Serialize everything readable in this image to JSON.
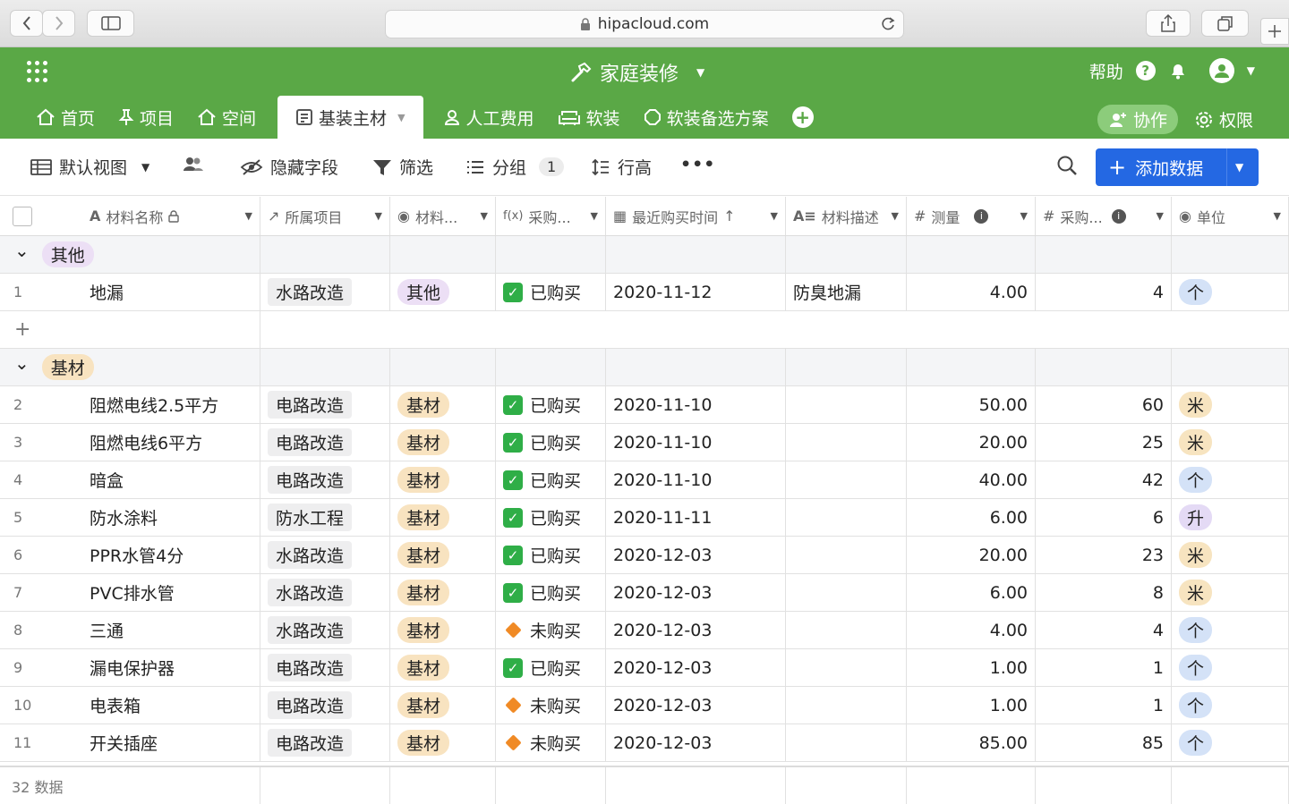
{
  "browser": {
    "url": "hipacloud.com"
  },
  "app": {
    "title": "家庭装修",
    "help_label": "帮助",
    "tabs": [
      {
        "label": "首页"
      },
      {
        "label": "项目"
      },
      {
        "label": "空间"
      },
      {
        "label": "基装主材"
      },
      {
        "label": "人工费用"
      },
      {
        "label": "软装"
      },
      {
        "label": "软装备选方案"
      }
    ],
    "collab_label": "协作",
    "perm_label": "权限"
  },
  "toolbar": {
    "view_label": "默认视图",
    "hide_fields": "隐藏字段",
    "filter": "筛选",
    "group": "分组",
    "group_count": "1",
    "row_height": "行高",
    "add_data": "添加数据"
  },
  "columns": [
    "材料名称",
    "所属项目",
    "材料...",
    "采购...",
    "最近购买时间",
    "材料描述",
    "测量",
    "采购...",
    "单位"
  ],
  "groups": [
    {
      "name": "其他",
      "rows": [
        {
          "n": "1",
          "name": "地漏",
          "project": "水路改造",
          "cat": "其他",
          "status": "已购买",
          "date": "2020-11-12",
          "desc": "防臭地漏",
          "measure": "4.00",
          "qty": "4",
          "unit": "个"
        }
      ]
    },
    {
      "name": "基材",
      "rows": [
        {
          "n": "2",
          "name": "阻燃电线2.5平方",
          "project": "电路改造",
          "cat": "基材",
          "status": "已购买",
          "date": "2020-11-10",
          "desc": "",
          "measure": "50.00",
          "qty": "60",
          "unit": "米"
        },
        {
          "n": "3",
          "name": "阻燃电线6平方",
          "project": "电路改造",
          "cat": "基材",
          "status": "已购买",
          "date": "2020-11-10",
          "desc": "",
          "measure": "20.00",
          "qty": "25",
          "unit": "米"
        },
        {
          "n": "4",
          "name": "暗盒",
          "project": "电路改造",
          "cat": "基材",
          "status": "已购买",
          "date": "2020-11-10",
          "desc": "",
          "measure": "40.00",
          "qty": "42",
          "unit": "个"
        },
        {
          "n": "5",
          "name": "防水涂料",
          "project": "防水工程",
          "cat": "基材",
          "status": "已购买",
          "date": "2020-11-11",
          "desc": "",
          "measure": "6.00",
          "qty": "6",
          "unit": "升"
        },
        {
          "n": "6",
          "name": "PPR水管4分",
          "project": "水路改造",
          "cat": "基材",
          "status": "已购买",
          "date": "2020-12-03",
          "desc": "",
          "measure": "20.00",
          "qty": "23",
          "unit": "米"
        },
        {
          "n": "7",
          "name": "PVC排水管",
          "project": "水路改造",
          "cat": "基材",
          "status": "已购买",
          "date": "2020-12-03",
          "desc": "",
          "measure": "6.00",
          "qty": "8",
          "unit": "米"
        },
        {
          "n": "8",
          "name": "三通",
          "project": "水路改造",
          "cat": "基材",
          "status": "未购买",
          "date": "2020-12-03",
          "desc": "",
          "measure": "4.00",
          "qty": "4",
          "unit": "个"
        },
        {
          "n": "9",
          "name": "漏电保护器",
          "project": "电路改造",
          "cat": "基材",
          "status": "已购买",
          "date": "2020-12-03",
          "desc": "",
          "measure": "1.00",
          "qty": "1",
          "unit": "个"
        },
        {
          "n": "10",
          "name": "电表箱",
          "project": "电路改造",
          "cat": "基材",
          "status": "未购买",
          "date": "2020-12-03",
          "desc": "",
          "measure": "1.00",
          "qty": "1",
          "unit": "个"
        },
        {
          "n": "11",
          "name": "开关插座",
          "project": "电路改造",
          "cat": "基材",
          "status": "未购买",
          "date": "2020-12-03",
          "desc": "",
          "measure": "85.00",
          "qty": "85",
          "unit": "个"
        }
      ]
    }
  ],
  "footer": {
    "count_label": "32 数据"
  },
  "colors": {
    "brand_green": "#5aa846",
    "primary_blue": "#2468e3",
    "chip_other": "#ecdff5",
    "chip_base": "#f8e3c0",
    "unit_ge": "#d4e2f7",
    "unit_mi": "#f7e4c0",
    "unit_sheng": "#e4daf5",
    "purchased": "#2fae47",
    "not_purchased": "#f08a25"
  }
}
